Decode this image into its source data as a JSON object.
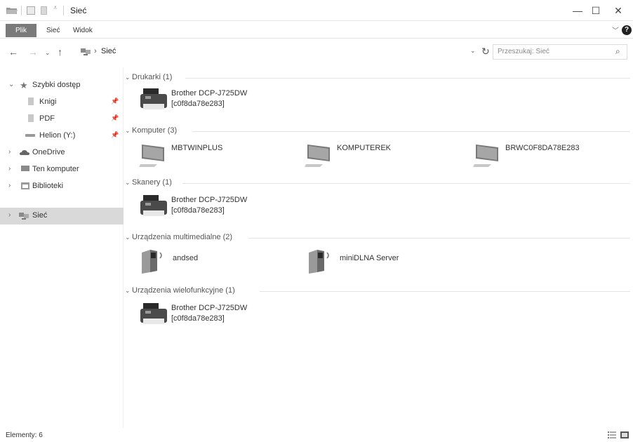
{
  "window": {
    "title": "Sieć"
  },
  "ribbon": {
    "tabs": [
      "Plik",
      "Sieć",
      "Widok"
    ]
  },
  "address": {
    "path": "Sieć",
    "search_placeholder": "Przeszukaj: Sieć"
  },
  "sidebar": {
    "items": [
      {
        "label": "Szybki dostęp",
        "icon": "star-icon"
      },
      {
        "label": "Knigi",
        "icon": "folder-icon",
        "pinned": true
      },
      {
        "label": "PDF",
        "icon": "folder-icon",
        "pinned": true
      },
      {
        "label": "Helion (Y:)",
        "icon": "network-drive-icon",
        "pinned": true
      },
      {
        "label": "OneDrive",
        "icon": "cloud-icon"
      },
      {
        "label": "Ten komputer",
        "icon": "computer-icon"
      },
      {
        "label": "Biblioteki",
        "icon": "library-icon"
      },
      {
        "label": "Sieć",
        "icon": "network-icon",
        "selected": true
      }
    ]
  },
  "groups": [
    {
      "title": "Drukarki (1)",
      "items": [
        {
          "name": "Brother DCP-J725DW",
          "sub": "[c0f8da78e283]",
          "icon": "printer-icon"
        }
      ]
    },
    {
      "title": "Komputer (3)",
      "items": [
        {
          "name": "MBTWINPLUS",
          "icon": "computer-icon"
        },
        {
          "name": "KOMPUTEREK",
          "icon": "computer-icon"
        },
        {
          "name": "BRWC0F8DA78E283",
          "icon": "computer-icon"
        }
      ]
    },
    {
      "title": "Skanery (1)",
      "items": [
        {
          "name": "Brother DCP-J725DW",
          "sub": "[c0f8da78e283]",
          "icon": "printer-icon"
        }
      ]
    },
    {
      "title": "Urządzenia multimedialne (2)",
      "items": [
        {
          "name": "andsed",
          "icon": "media-device-icon"
        },
        {
          "name": "miniDLNA Server",
          "icon": "media-device-icon"
        }
      ]
    },
    {
      "title": "Urządzenia wielofunkcyjne (1)",
      "items": [
        {
          "name": "Brother DCP-J725DW",
          "sub": "[c0f8da78e283]",
          "icon": "printer-icon"
        }
      ]
    }
  ],
  "status": {
    "text": "Elementy: 6"
  }
}
